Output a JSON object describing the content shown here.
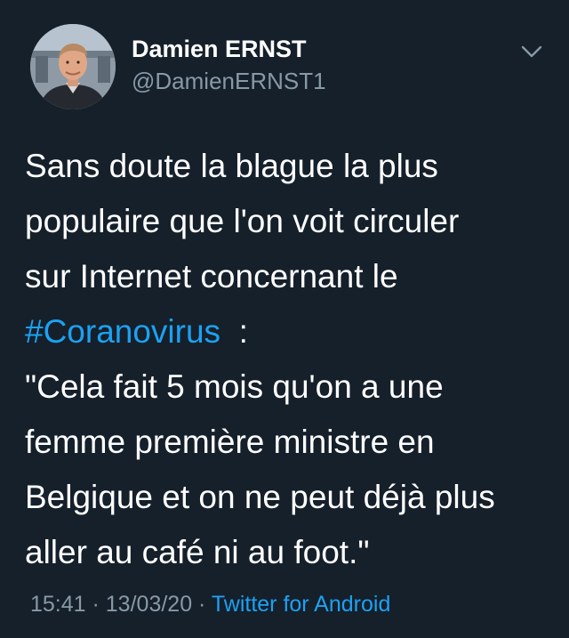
{
  "author": {
    "display_name": "Damien ERNST",
    "handle": "@DamienERNST1"
  },
  "icons": {
    "menu": "chevron-down-icon",
    "avatar": "profile-photo"
  },
  "tweet": {
    "line1": "Sans doute la blague la plus",
    "line2": "populaire que l'on voit circuler",
    "line3": "sur Internet concernant le",
    "hashtag": "#Coranovirus",
    "line4_rest": "  :",
    "line5": "\"Cela fait 5 mois qu'on a une",
    "line6": "femme première ministre en",
    "line7": "Belgique et on ne peut déjà plus",
    "line8": "aller au café ni au foot.\""
  },
  "meta": {
    "time": "15:41",
    "sep1": " · ",
    "date": "13/03/20",
    "sep2": " · ",
    "source": "Twitter for Android"
  },
  "colors": {
    "background": "#15202b",
    "link": "#1da1f2",
    "secondary_text": "#8899a6",
    "primary_text": "#ffffff"
  }
}
